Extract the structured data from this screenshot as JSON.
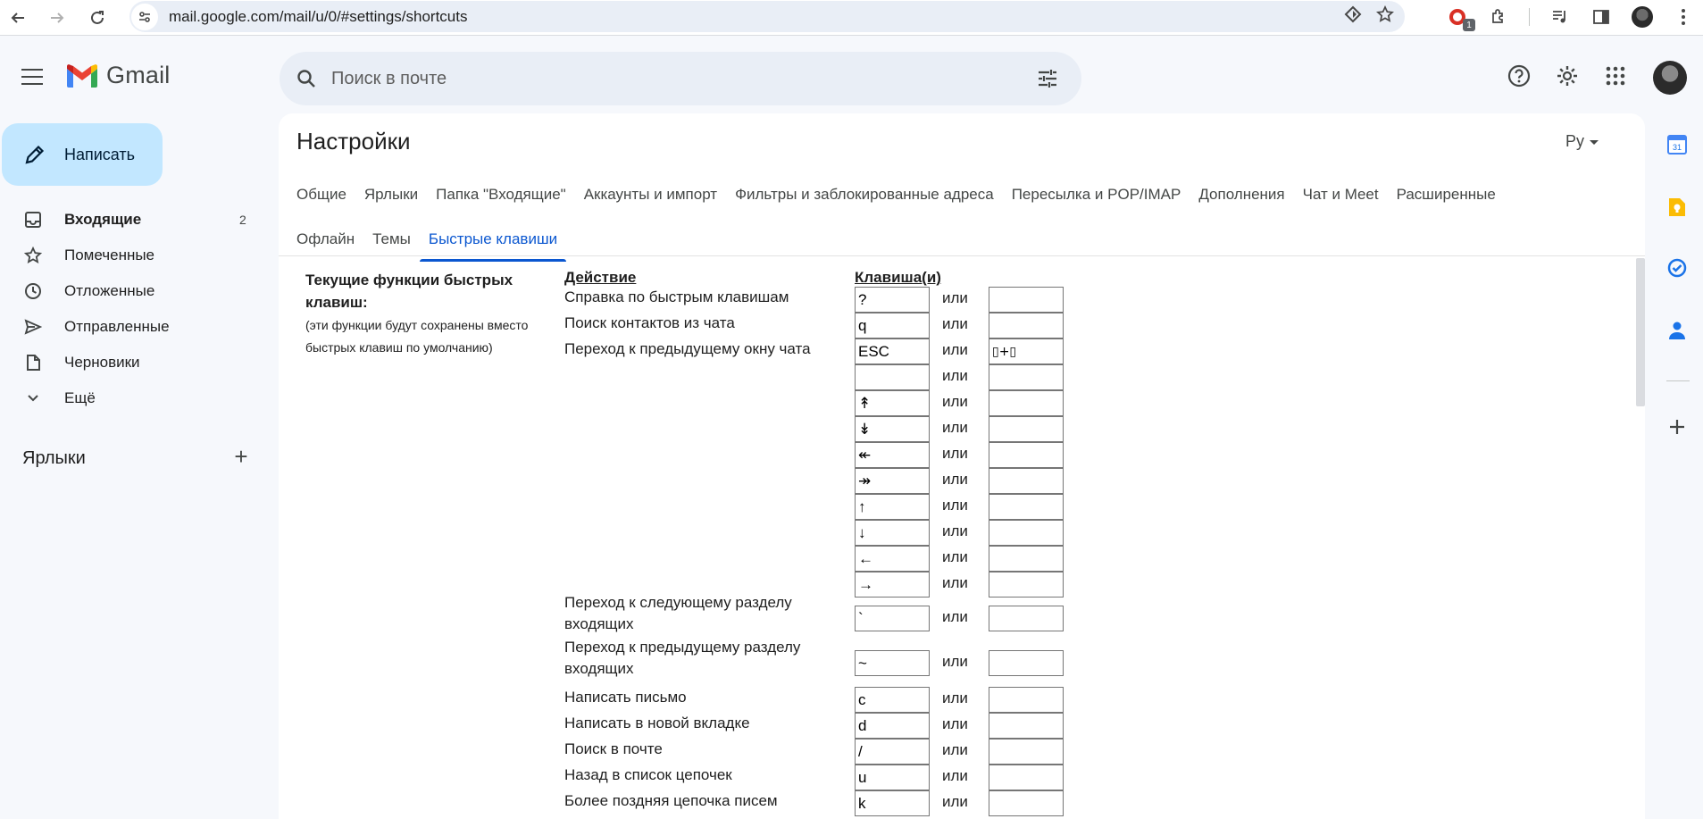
{
  "browser": {
    "url": "mail.google.com/mail/u/0/#settings/shortcuts",
    "ext_badge": "1"
  },
  "app": {
    "name": "Gmail",
    "search_placeholder": "Поиск в почте"
  },
  "sidebar": {
    "compose": "Написать",
    "items": [
      {
        "label": "Входящие",
        "count": "2",
        "icon": "inbox-icon"
      },
      {
        "label": "Помеченные",
        "count": "",
        "icon": "star-icon"
      },
      {
        "label": "Отложенные",
        "count": "",
        "icon": "clock-icon"
      },
      {
        "label": "Отправленные",
        "count": "",
        "icon": "send-icon"
      },
      {
        "label": "Черновики",
        "count": "",
        "icon": "draft-icon"
      },
      {
        "label": "Ещё",
        "count": "",
        "icon": "chevron-down-icon"
      }
    ],
    "labels_title": "Ярлыки"
  },
  "settings": {
    "title": "Настройки",
    "lang": "Ру",
    "tabs_row1": [
      "Общие",
      "Ярлыки",
      "Папка \"Входящие\"",
      "Аккаунты и импорт",
      "Фильтры и заблокированные адреса",
      "Пересылка и POP/IMAP",
      "Дополнения",
      "Чат и Meet",
      "Расширенные"
    ],
    "tabs_row2": [
      "Офлайн",
      "Темы",
      "Быстрые клавиши"
    ],
    "active_tab": "Быстрые клавиши",
    "section_title": "Текущие функции быстрых клавиш:",
    "section_note": "(эти функции будут сохранены вместо быстрых клавиш по умолчанию)",
    "col_action": "Действие",
    "col_keys": "Клавиша(и)",
    "or_label": "или"
  },
  "shortcuts": [
    {
      "action": "Справка по быстрым клавишам",
      "key1": "?",
      "key2": ""
    },
    {
      "action": "Поиск контактов из чата",
      "key1": "q",
      "key2": ""
    },
    {
      "action": "Переход к предыдущему окну чата",
      "key1": "ESC",
      "key2": "▯+▯"
    },
    {
      "action": "",
      "key1": "",
      "key2": ""
    },
    {
      "action": "",
      "key1": "↟",
      "key2": ""
    },
    {
      "action": "",
      "key1": "↡",
      "key2": ""
    },
    {
      "action": "",
      "key1": "↞",
      "key2": ""
    },
    {
      "action": "",
      "key1": "↠",
      "key2": ""
    },
    {
      "action": "",
      "key1": "↑",
      "key2": ""
    },
    {
      "action": "",
      "key1": "↓",
      "key2": ""
    },
    {
      "action": "",
      "key1": "←",
      "key2": ""
    },
    {
      "action": "",
      "key1": "→",
      "key2": ""
    },
    {
      "action": "Переход к следующему разделу входящих",
      "key1": "`",
      "key2": ""
    },
    {
      "action": "Переход к предыдущему разделу входящих",
      "key1": "~",
      "key2": ""
    },
    {
      "action": "Написать письмо",
      "key1": "c",
      "key2": ""
    },
    {
      "action": "Написать в новой вкладке",
      "key1": "d",
      "key2": ""
    },
    {
      "action": "Поиск в почте",
      "key1": "/",
      "key2": ""
    },
    {
      "action": "Назад в список цепочек",
      "key1": "u",
      "key2": ""
    },
    {
      "action": "Более поздняя цепочка писем",
      "key1": "k",
      "key2": ""
    }
  ]
}
